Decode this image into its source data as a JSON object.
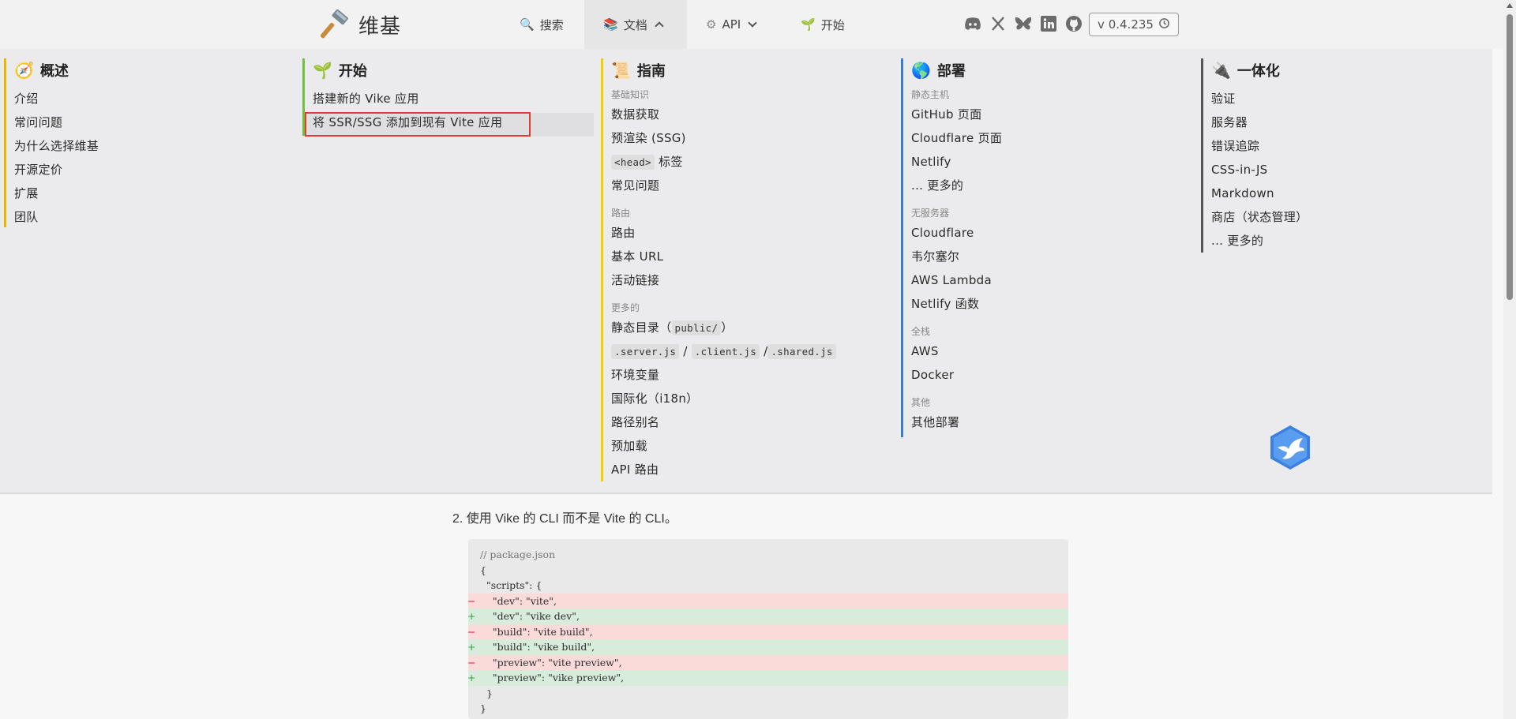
{
  "brand": {
    "name": "维基"
  },
  "nav": {
    "search": "搜索",
    "docs": "文档",
    "api": "API",
    "start": "开始"
  },
  "social": [
    "discord-icon",
    "x-icon",
    "bluesky-icon",
    "linkedin-icon",
    "github-icon"
  ],
  "version": "v 0.4.235",
  "menu": {
    "overview": {
      "title": "概述",
      "items": [
        "介绍",
        "常问问题",
        "为什么选择维基",
        "开源定价",
        "扩展",
        "团队"
      ]
    },
    "start": {
      "title": "开始",
      "items": [
        "搭建新的 Vike 应用",
        "将 SSR/SSG 添加到现有 Vite 应用"
      ]
    },
    "guide": {
      "title": "指南",
      "basics": "基础知识",
      "basics_items": [
        "数据获取",
        "预渲染 (SSG)",
        "常见问题"
      ],
      "head_tag": "<head>",
      "head_label": "标签",
      "routing": "路由",
      "routing_items": [
        "路由",
        "基本 URL",
        "活动链接"
      ],
      "more": "更多的",
      "static_dir": "静态目录（",
      "public_code": "public/",
      "static_dir_end": "）",
      "server_js": ".server.js",
      "client_js": ".client.js",
      "shared_js": ".shared.js",
      "slash": "/",
      "more_items": [
        "环境变量",
        "国际化（i18n）",
        "路径别名",
        "预加载",
        "API 路由"
      ]
    },
    "deploy": {
      "title": "部署",
      "static_host": "静态主机",
      "static_items": [
        "GitHub 页面",
        "Cloudflare 页面",
        "Netlify",
        "... 更多的"
      ],
      "serverless": "无服务器",
      "serverless_items": [
        "Cloudflare",
        "韦尔塞尔",
        "AWS Lambda",
        "Netlify 函数"
      ],
      "fullstack": "全栈",
      "fullstack_items": [
        "AWS",
        "Docker"
      ],
      "other": "其他",
      "other_items": [
        "其他部署"
      ]
    },
    "integration": {
      "title": "一体化",
      "items": [
        "验证",
        "服务器",
        "错误追踪",
        "CSS-in-JS",
        "Markdown",
        "商店（状态管理）",
        "... 更多的"
      ]
    }
  },
  "content": {
    "step": "2. 使用 Vike 的 CLI 而不是 Vite 的 CLI。",
    "code": [
      {
        "t": "ctx",
        "s": "// package.json"
      },
      {
        "t": "ctx",
        "s": "{"
      },
      {
        "t": "ctx",
        "s": "  \"scripts\": {"
      },
      {
        "t": "del",
        "s": "    \"dev\": \"vite\","
      },
      {
        "t": "add",
        "s": "    \"dev\": \"vike dev\","
      },
      {
        "t": "del",
        "s": "    \"build\": \"vite build\","
      },
      {
        "t": "add",
        "s": "    \"build\": \"vike build\","
      },
      {
        "t": "del",
        "s": "    \"preview\": \"vite preview\","
      },
      {
        "t": "add",
        "s": "    \"preview\": \"vike preview\","
      },
      {
        "t": "ctx",
        "s": "  }"
      },
      {
        "t": "ctx",
        "s": "}"
      }
    ]
  },
  "colors": {
    "overview_bar": "#f0b400",
    "start_bar": "#6fc23a",
    "guide_bar": "#f2d000",
    "deploy_bar": "#3a7bd5",
    "integration_bar": "#555555",
    "highlight_border": "#e53935"
  }
}
